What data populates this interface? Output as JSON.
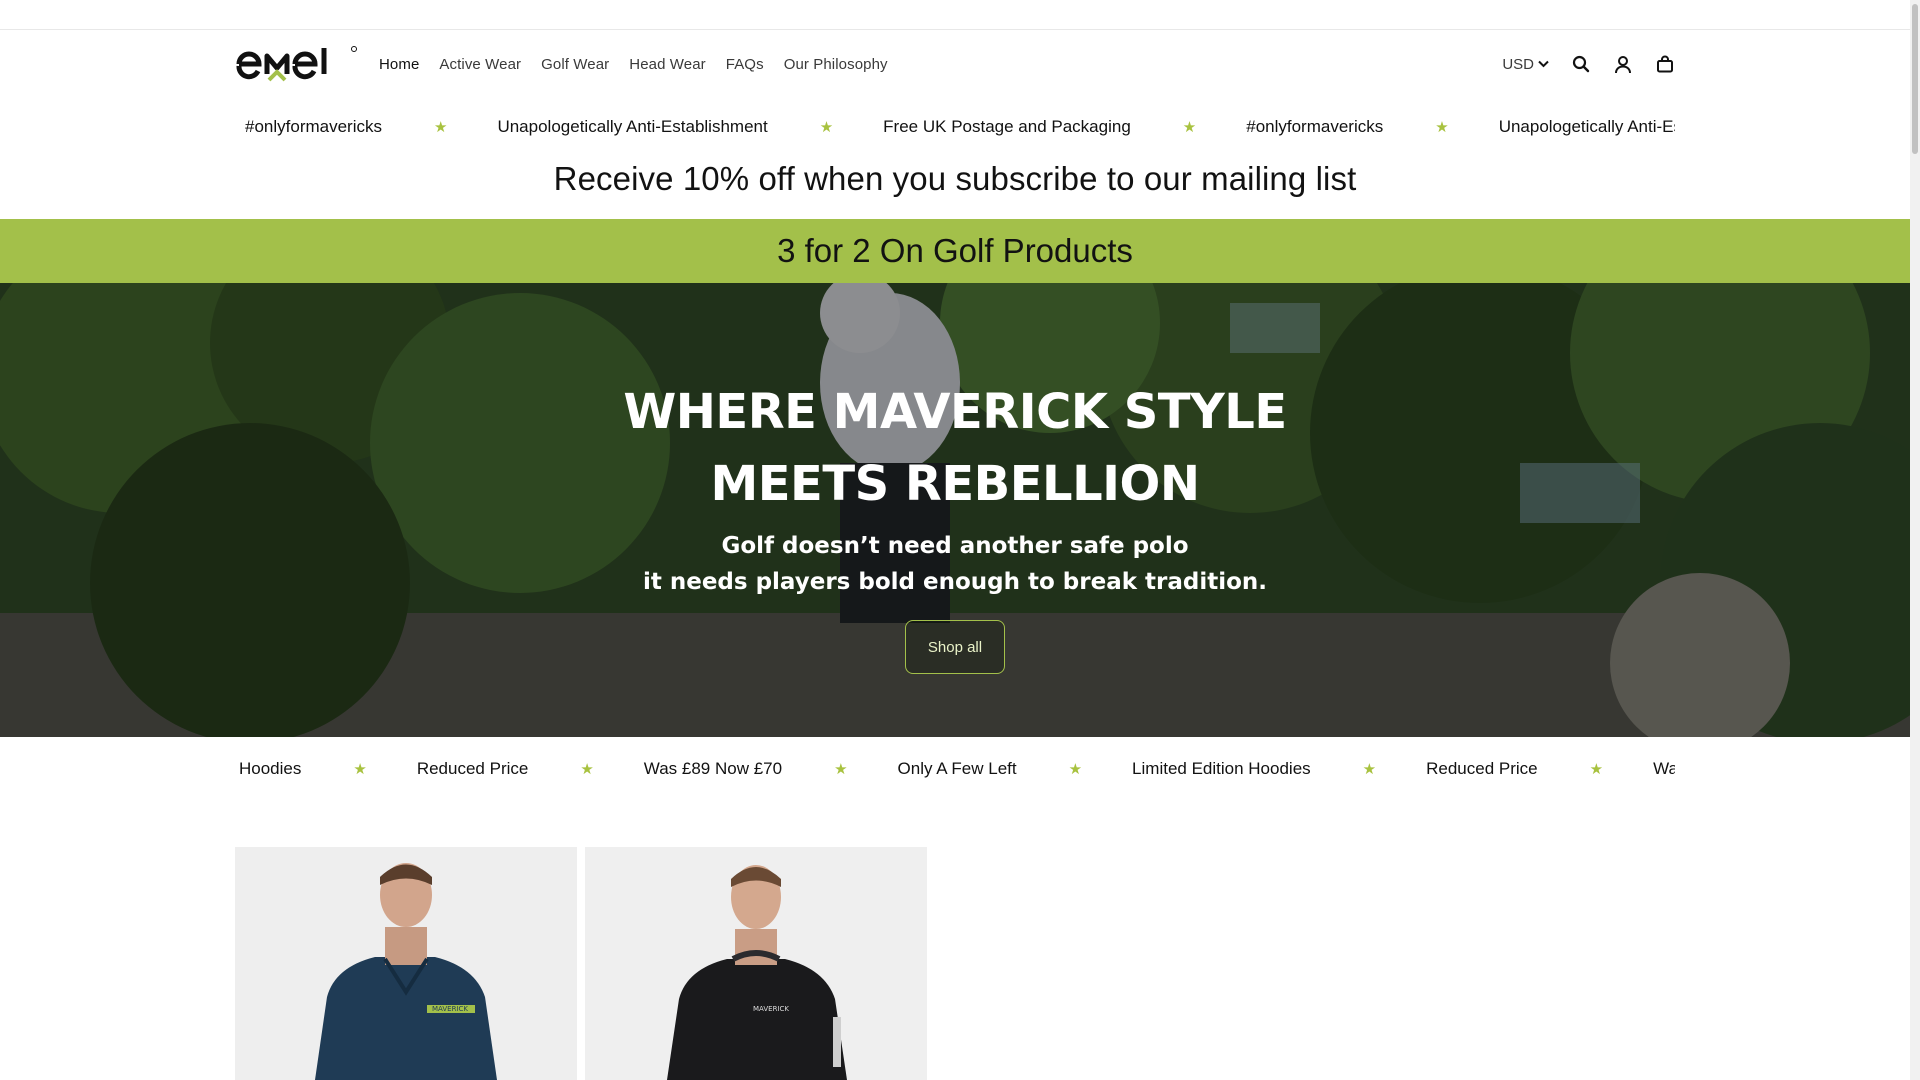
{
  "header": {
    "logo_text": "emel",
    "nav": [
      {
        "label": "Home"
      },
      {
        "label": "Active Wear"
      },
      {
        "label": "Golf Wear"
      },
      {
        "label": "Head Wear"
      },
      {
        "label": "FAQs"
      },
      {
        "label": "Our Philosophy"
      }
    ],
    "currency": "USD",
    "icons": [
      "search-icon",
      "account-icon",
      "bag-icon"
    ]
  },
  "announcement": {
    "items": [
      "#onlyformavericks",
      "Unapologetically Anti-Establishment",
      "Free UK Postage and Packaging",
      "#onlyformavericks",
      "Unapologetically Anti-Es"
    ],
    "separator": "★"
  },
  "subscribe_text": "Receive 10% off when you subscribe to our mailing list",
  "promo_text": "3 for 2 On Golf Products",
  "hero": {
    "title_line1": "WHERE MAVERICK STYLE",
    "title_line2": "MEETS REBELLION",
    "sub_line1": "Golf doesn’t need another safe polo",
    "sub_line2": "it needs players bold enough to break tradition.",
    "button_label": "Shop all"
  },
  "ticker": {
    "items": [
      "Hoodies",
      "Reduced Price",
      "Was £89 Now £70",
      "Only A Few Left",
      "Limited Edition Hoodies",
      "Reduced Price",
      "Was"
    ],
    "separator": "★"
  },
  "products": [
    {
      "image": "navy-quarter-zip-hoodie",
      "chest_text": "MAVERICK"
    },
    {
      "image": "black-quarter-zip-hoodie",
      "chest_text": "MAVERICK"
    }
  ],
  "colors": {
    "accent": "#a3c04a",
    "text": "#121212"
  }
}
